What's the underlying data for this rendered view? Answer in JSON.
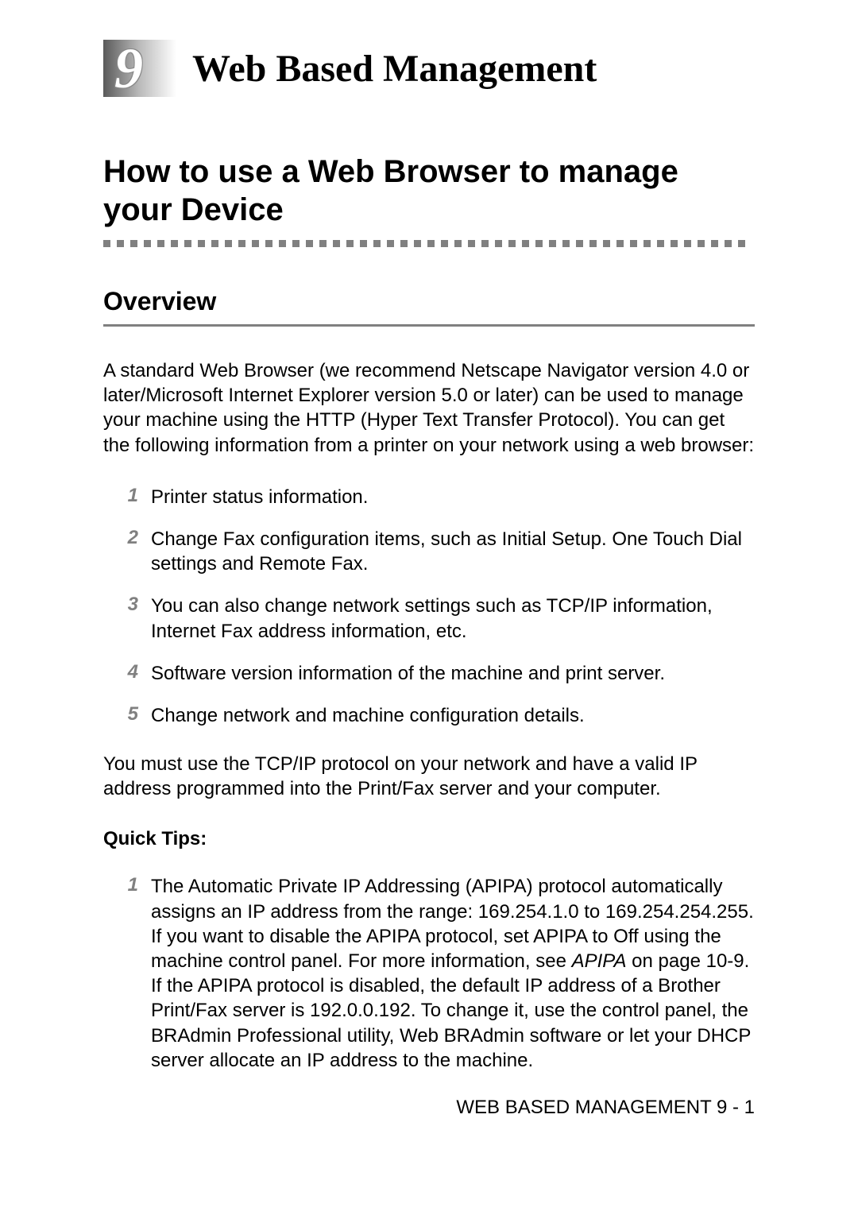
{
  "chapter": {
    "number": "9",
    "title": "Web Based Management"
  },
  "section": {
    "heading": "How to use a Web Browser to manage your Device"
  },
  "subsection": {
    "heading": "Overview"
  },
  "intro_paragraph": "A standard Web Browser (we recommend Netscape Navigator version 4.0 or later/Microsoft Internet Explorer version 5.0 or later) can be used to manage your machine using the HTTP (Hyper Text Transfer Protocol). You can get the following information from a printer on your network using a web browser:",
  "numbered_items": [
    "Printer status information.",
    "Change Fax configuration items, such as Initial Setup. One Touch Dial settings and Remote Fax.",
    "You can also change network settings such as TCP/IP information, Internet Fax address information, etc.",
    "Software version information of the machine and print server.",
    "Change network and machine configuration details."
  ],
  "requirement_paragraph": "You must use the TCP/IP protocol on your network and have a valid IP address programmed into the Print/Fax server and your computer.",
  "quick_tips": {
    "heading": "Quick Tips:",
    "items": [
      {
        "pre": "The Automatic Private IP Addressing (APIPA) protocol automatically assigns an IP address from the range: 169.254.1.0 to 169.254.254.255. If you want to disable the APIPA protocol, set APIPA to Off using the machine control panel. For more information, see ",
        "italic": "APIPA",
        "post": " on page 10-9. If the APIPA protocol is disabled, the default IP address of a Brother Print/Fax server is 192.0.0.192. To change it, use the control panel, the BRAdmin Professional utility, Web BRAdmin software or let your DHCP server allocate an IP address to the machine."
      }
    ]
  },
  "footer": "WEB BASED MANAGEMENT 9 - 1"
}
